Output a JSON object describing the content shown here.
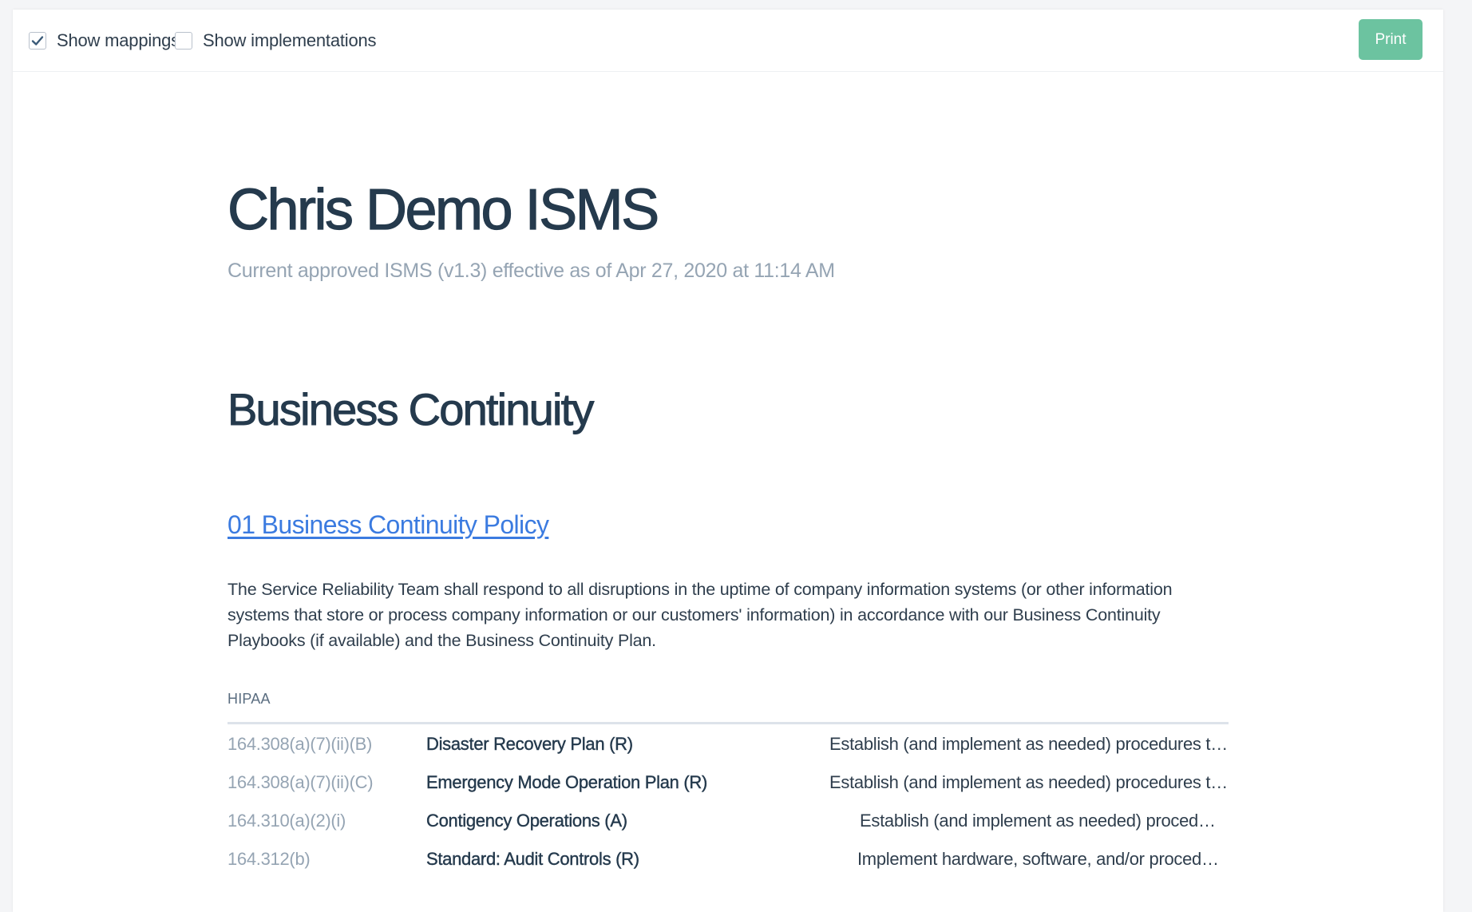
{
  "toolbar": {
    "show_mappings_label": "Show mappings",
    "show_mappings_checked": true,
    "show_implementations_label": "Show implementations",
    "show_implementations_checked": false,
    "print_label": "Print",
    "print_color": "#6cc3a0",
    "checkbox_icon": "check-icon"
  },
  "document": {
    "title": "Chris Demo ISMS",
    "subtitle": "Current approved ISMS (v1.3) effective as of Apr 27, 2020 at 11:14 AM"
  },
  "section": {
    "title": "Business Continuity",
    "policy": {
      "link_label": "01 Business Continuity Policy",
      "link_color": "#3b7be0",
      "text": "The Service Reliability Team shall respond to all disruptions in the uptime of company information systems (or other information systems that store or process company information or our customers' information) in accordance with our Business Continuity Playbooks (if available) and the Business Continuity Plan.",
      "framework": {
        "label": "HIPAA",
        "mappings": [
          {
            "ref": "164.308(a)(7)(ii)(B)",
            "name": "Disaster Recovery Plan (R)",
            "description": "Establish (and implement as needed) procedures to restore any loss of data."
          },
          {
            "ref": "164.308(a)(7)(ii)(C)",
            "name": "Emergency Mode Operation Plan (R)",
            "description": "Establish (and implement as needed) procedures to enable continuation of critical business processes."
          },
          {
            "ref": "164.310(a)(2)(i)",
            "name": "Contigency Operations (A)",
            "description": "Establish (and implement as needed) procedures that allow facility access."
          },
          {
            "ref": "164.312(b)",
            "name": "Standard: Audit Controls (R)",
            "description": "Implement hardware, software, and/or procedural mechanisms that record and examine activity."
          }
        ]
      }
    }
  }
}
